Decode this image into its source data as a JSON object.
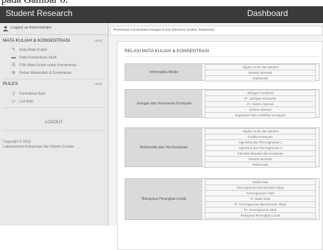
{
  "caption": "pada Gambar 6.",
  "header": {
    "app_title": "Student Research",
    "page_title": "Dashboard"
  },
  "user": {
    "logged_as": "Logged as Administrator"
  },
  "sidebar": {
    "section1": {
      "title": "MATA KULIAH & KONSENTRASI",
      "hide": "HIDE",
      "items": [
        {
          "icon": "pencil-icon",
          "label": "Data Mata Kuliah"
        },
        {
          "icon": "folders-icon",
          "label": "Data Konsentrasi Studi"
        },
        {
          "icon": "list-icon",
          "label": "Pilih Mata Kuliah untuk Konsentrasi"
        },
        {
          "icon": "pin-icon",
          "label": "Relasi Matakuliah & Konsentrasi"
        }
      ]
    },
    "section2": {
      "title": "RULES",
      "hide": "HIDE",
      "items": [
        {
          "icon": "document-icon",
          "label": "Formatmat Rule"
        },
        {
          "icon": "folder-icon",
          "label": "List Rule"
        }
      ]
    },
    "logout": "LOGOUT",
    "copyright": "Copyright © 2012\nLaboratorium Komputasi dan Sistem Cerdas"
  },
  "breadcrumb": "Penentuan Konsentrasi Dengan Fuzzy Inference System Tsukamoto",
  "panel": {
    "title": "RELASI MATA KULIAH & KONSENTRASI",
    "groups": [
      {
        "name": "Informatika Medis",
        "courses": [
          "Aljabar Linier dan Matriks",
          "Metode Numerik",
          "Multimedia"
        ]
      },
      {
        "name": "Jaringan dan Keamanan Komputer",
        "courses": [
          "Jaringan Komputer",
          "Pr. Jaringan Komputer",
          "Pr. Sistem Operasi",
          "Sistem Operasi",
          "Organisasi dan Arsitektur Komputer"
        ]
      },
      {
        "name": "Multimedia dan Visi Komputer",
        "courses": [
          "Aljabar Linier dan Matriks",
          "Grafika Komputer",
          "Algoritma dan Pemrograman 1",
          "Algoritma dan Pemrograman 2",
          "Interaksi Manusia dan Komputer",
          "Metode Numerik",
          "Multimedia"
        ]
      },
      {
        "name": "Rekayasa Perangkat Lunak",
        "courses": [
          "Basis Data",
          "Pemrograman Berorientasi Objek",
          "Pemrograman Web",
          "Pr. Basis Data",
          "Pr. Pemrograman Berorientasi Objek",
          "Pr. Pemrograman Web",
          "Rekayasa Perangkat Lunak"
        ]
      }
    ]
  }
}
